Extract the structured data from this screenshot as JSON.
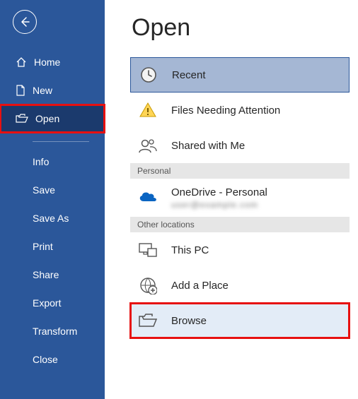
{
  "colors": {
    "brand": "#2b579a",
    "highlight": "#e71010"
  },
  "sidebar": {
    "primary": [
      {
        "id": "home",
        "label": "Home",
        "icon": "home-icon"
      },
      {
        "id": "new",
        "label": "New",
        "icon": "document-icon"
      },
      {
        "id": "open",
        "label": "Open",
        "icon": "folder-open-icon",
        "selected": true,
        "highlight": true
      }
    ],
    "secondary": [
      {
        "id": "info",
        "label": "Info"
      },
      {
        "id": "save",
        "label": "Save"
      },
      {
        "id": "saveas",
        "label": "Save As"
      },
      {
        "id": "print",
        "label": "Print"
      },
      {
        "id": "share",
        "label": "Share"
      },
      {
        "id": "export",
        "label": "Export"
      },
      {
        "id": "transform",
        "label": "Transform"
      },
      {
        "id": "close",
        "label": "Close"
      }
    ]
  },
  "main": {
    "title": "Open",
    "locations_top": [
      {
        "id": "recent",
        "label": "Recent",
        "icon": "clock-icon",
        "selected": true
      },
      {
        "id": "attention",
        "label": "Files Needing Attention",
        "icon": "warning-icon"
      },
      {
        "id": "shared",
        "label": "Shared with Me",
        "icon": "people-icon"
      }
    ],
    "section_personal": "Personal",
    "onedrive": {
      "label": "OneDrive - Personal",
      "sub_redacted": "user@example.com"
    },
    "section_other": "Other locations",
    "locations_other": [
      {
        "id": "thispc",
        "label": "This PC",
        "icon": "this-pc-icon"
      },
      {
        "id": "addplace",
        "label": "Add a Place",
        "icon": "add-place-icon"
      },
      {
        "id": "browse",
        "label": "Browse",
        "icon": "folder-open-icon",
        "highlight": true,
        "hover": true
      }
    ]
  }
}
